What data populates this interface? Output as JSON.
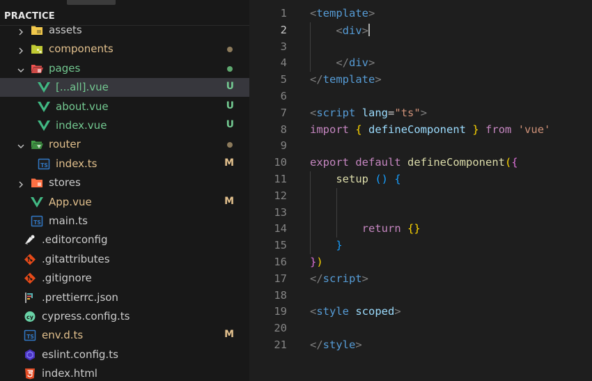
{
  "top_crop": {
    "text": "…"
  },
  "explorer": {
    "section_title": "PRACTICE",
    "items": [
      {
        "label": "assets",
        "kind": "folder-assets",
        "expanded": false,
        "depth": 1,
        "status": "",
        "color": "#cccccc"
      },
      {
        "label": "components",
        "kind": "folder-components",
        "expanded": false,
        "depth": 1,
        "status": "dot",
        "color": "#e2c08d"
      },
      {
        "label": "pages",
        "kind": "folder-pages",
        "expanded": true,
        "depth": 1,
        "status": "dot-green",
        "color": "#73c991"
      },
      {
        "label": "[...all].vue",
        "kind": "vue",
        "depth": 2,
        "status": "U",
        "color": "#73c991",
        "selected": true
      },
      {
        "label": "about.vue",
        "kind": "vue",
        "depth": 2,
        "status": "U",
        "color": "#73c991"
      },
      {
        "label": "index.vue",
        "kind": "vue",
        "depth": 2,
        "status": "U",
        "color": "#73c991"
      },
      {
        "label": "router",
        "kind": "folder-router",
        "expanded": true,
        "depth": 1,
        "status": "dot",
        "color": "#e2c08d"
      },
      {
        "label": "index.ts",
        "kind": "ts",
        "depth": 2,
        "status": "M",
        "color": "#e2c08d"
      },
      {
        "label": "stores",
        "kind": "folder-stores",
        "expanded": false,
        "depth": 1,
        "status": "",
        "color": "#cccccc"
      },
      {
        "label": "App.vue",
        "kind": "vue",
        "depth": 1,
        "status": "M",
        "color": "#e2c08d"
      },
      {
        "label": "main.ts",
        "kind": "ts",
        "depth": 1,
        "status": "",
        "color": "#cccccc"
      },
      {
        "label": ".editorconfig",
        "kind": "editorconfig",
        "depth": 0,
        "status": "",
        "color": "#cccccc"
      },
      {
        "label": ".gitattributes",
        "kind": "git",
        "depth": 0,
        "status": "",
        "color": "#cccccc"
      },
      {
        "label": ".gitignore",
        "kind": "git",
        "depth": 0,
        "status": "",
        "color": "#cccccc"
      },
      {
        "label": ".prettierrc.json",
        "kind": "prettier",
        "depth": 0,
        "status": "",
        "color": "#cccccc"
      },
      {
        "label": "cypress.config.ts",
        "kind": "cypress",
        "depth": 0,
        "status": "",
        "color": "#cccccc"
      },
      {
        "label": "env.d.ts",
        "kind": "ts",
        "depth": 0,
        "status": "M",
        "color": "#e2c08d"
      },
      {
        "label": "eslint.config.ts",
        "kind": "eslint",
        "depth": 0,
        "status": "",
        "color": "#cccccc"
      },
      {
        "label": "index.html",
        "kind": "html",
        "depth": 0,
        "status": "",
        "color": "#cccccc"
      }
    ]
  },
  "editor": {
    "active_line": 2,
    "lines": [
      [
        [
          "t-brk",
          "<"
        ],
        [
          "t-tag",
          "template"
        ],
        [
          "t-brk",
          ">"
        ]
      ],
      [
        [
          "t-txt",
          "    "
        ],
        [
          "t-brk",
          "<"
        ],
        [
          "t-tag",
          "div"
        ],
        [
          "t-brk",
          ">"
        ],
        [
          "caret",
          ""
        ]
      ],
      [],
      [
        [
          "t-txt",
          "    "
        ],
        [
          "t-brk",
          "</"
        ],
        [
          "t-tag",
          "div"
        ],
        [
          "t-brk",
          ">"
        ]
      ],
      [
        [
          "t-brk",
          "</"
        ],
        [
          "t-tag",
          "template"
        ],
        [
          "t-brk",
          ">"
        ]
      ],
      [],
      [
        [
          "t-brk",
          "<"
        ],
        [
          "t-tag",
          "script"
        ],
        [
          "t-txt",
          " "
        ],
        [
          "t-attr",
          "lang"
        ],
        [
          "t-txt",
          "="
        ],
        [
          "t-str",
          "\"ts\""
        ],
        [
          "t-brk",
          ">"
        ]
      ],
      [
        [
          "t-kw",
          "import"
        ],
        [
          "t-txt",
          " "
        ],
        [
          "t-br1",
          "{"
        ],
        [
          "t-txt",
          " "
        ],
        [
          "t-attr",
          "defineComponent"
        ],
        [
          "t-txt",
          " "
        ],
        [
          "t-br1",
          "}"
        ],
        [
          "t-txt",
          " "
        ],
        [
          "t-kw",
          "from"
        ],
        [
          "t-txt",
          " "
        ],
        [
          "t-str",
          "'vue'"
        ]
      ],
      [],
      [
        [
          "t-kw",
          "export"
        ],
        [
          "t-txt",
          " "
        ],
        [
          "t-kw",
          "default"
        ],
        [
          "t-txt",
          " "
        ],
        [
          "t-fn",
          "defineComponent"
        ],
        [
          "t-br1",
          "("
        ],
        [
          "t-br2",
          "{"
        ]
      ],
      [
        [
          "t-txt",
          "    "
        ],
        [
          "t-fn",
          "setup"
        ],
        [
          "t-txt",
          " "
        ],
        [
          "t-br3",
          "()"
        ],
        [
          "t-txt",
          " "
        ],
        [
          "t-br3",
          "{"
        ]
      ],
      [],
      [],
      [
        [
          "t-txt",
          "        "
        ],
        [
          "t-kw",
          "return"
        ],
        [
          "t-txt",
          " "
        ],
        [
          "t-br1",
          "{}"
        ]
      ],
      [
        [
          "t-txt",
          "    "
        ],
        [
          "t-br3",
          "}"
        ]
      ],
      [
        [
          "t-br2",
          "}"
        ],
        [
          "t-br1",
          ")"
        ]
      ],
      [
        [
          "t-brk",
          "</"
        ],
        [
          "t-tag",
          "script"
        ],
        [
          "t-brk",
          ">"
        ]
      ],
      [],
      [
        [
          "t-brk",
          "<"
        ],
        [
          "t-tag",
          "style"
        ],
        [
          "t-txt",
          " "
        ],
        [
          "t-attr",
          "scoped"
        ],
        [
          "t-brk",
          ">"
        ]
      ],
      [],
      [
        [
          "t-brk",
          "</"
        ],
        [
          "t-tag",
          "style"
        ],
        [
          "t-brk",
          ">"
        ]
      ]
    ]
  }
}
